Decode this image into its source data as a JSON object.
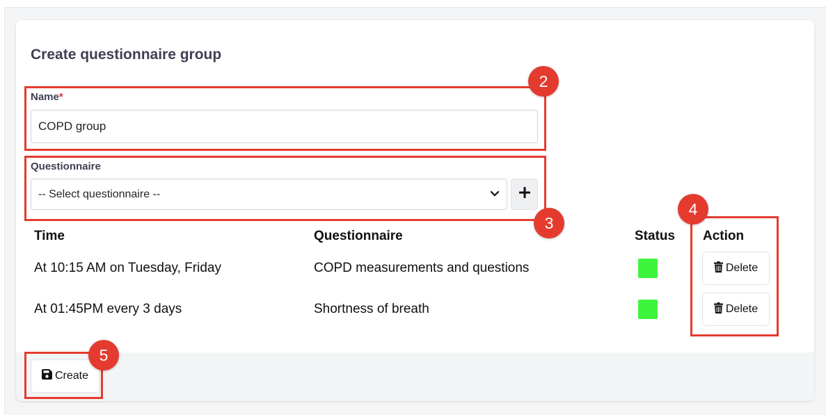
{
  "form": {
    "title": "Create questionnaire group",
    "name_label": "Name",
    "required_mark": "*",
    "name_value": "COPD group",
    "questionnaire_label": "Questionnaire",
    "questionnaire_select": "-- Select questionnaire --",
    "add_icon": "plus-icon"
  },
  "table": {
    "headers": {
      "time": "Time",
      "questionnaire": "Questionnaire",
      "status": "Status",
      "action": "Action"
    },
    "rows": [
      {
        "time": "At 10:15 AM on Tuesday, Friday",
        "questionnaire": "COPD measurements and questions",
        "status_color": "#3ef53e",
        "delete_label": "Delete"
      },
      {
        "time": "At 01:45PM every 3 days",
        "questionnaire": "Shortness of breath",
        "status_color": "#3ef53e",
        "delete_label": "Delete"
      }
    ]
  },
  "footer": {
    "create_label": "Create",
    "create_icon": "save-icon"
  },
  "annotations": {
    "badges": [
      "2",
      "3",
      "4",
      "5"
    ],
    "color": "#e53b2f"
  }
}
